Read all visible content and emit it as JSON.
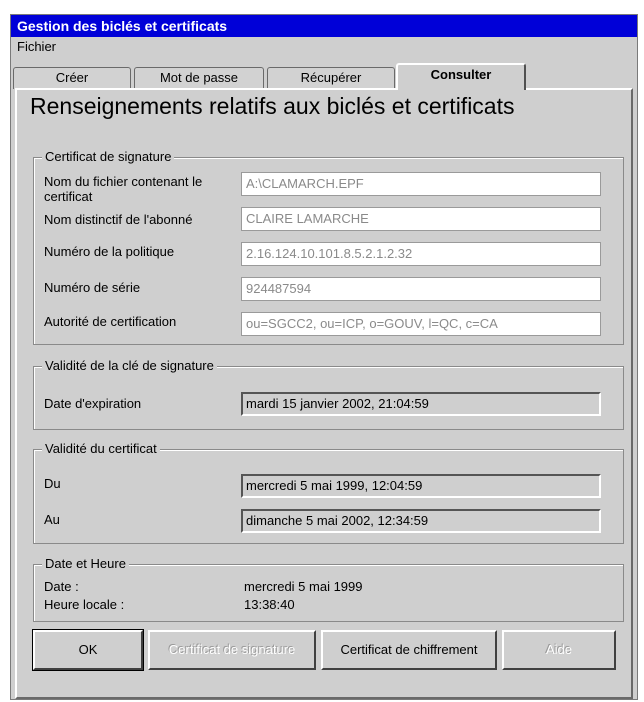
{
  "window": {
    "title": "Gestion des biclés et certificats"
  },
  "menu": {
    "file": "Fichier"
  },
  "tabs": [
    {
      "label": "Créer"
    },
    {
      "label": "Mot de passe"
    },
    {
      "label": "Récupérer"
    },
    {
      "label": "Consulter",
      "active": true
    }
  ],
  "page_title": "Renseignements relatifs aux biclés et certificats",
  "signature_certificate": {
    "legend": "Certificat de signature",
    "file_label": "Nom du fichier contenant le certificat",
    "file_value": "A:\\CLAMARCH.EPF",
    "subscriber_label": "Nom distinctif de l'abonné",
    "subscriber_value": "CLAIRE LAMARCHE",
    "policy_label": "Numéro de la politique",
    "policy_value": "2.16.124.10.101.8.5.2.1.2.32",
    "serial_label": "Numéro de série",
    "serial_value": "924487594",
    "authority_label": "Autorité de certification",
    "authority_value": "ou=SGCC2, ou=ICP, o=GOUV, l=QC, c=CA"
  },
  "key_validity": {
    "legend": "Validité de la clé de signature",
    "expiry_label": "Date d'expiration",
    "expiry_value": "mardi 15 janvier 2002, 21:04:59"
  },
  "cert_validity": {
    "legend": "Validité du certificat",
    "from_label": "Du",
    "from_value": "mercredi 5 mai 1999, 12:04:59",
    "to_label": "Au",
    "to_value": "dimanche 5 mai 2002, 12:34:59"
  },
  "datetime": {
    "legend": "Date et Heure",
    "date_label": "Date :",
    "date_value": "mercredi 5 mai 1999",
    "time_label": "Heure locale :",
    "time_value": "13:38:40"
  },
  "buttons": {
    "ok": "OK",
    "signature_cert": "Certificat de signature",
    "encryption_cert": "Certificat de chiffrement",
    "help": "Aide"
  }
}
